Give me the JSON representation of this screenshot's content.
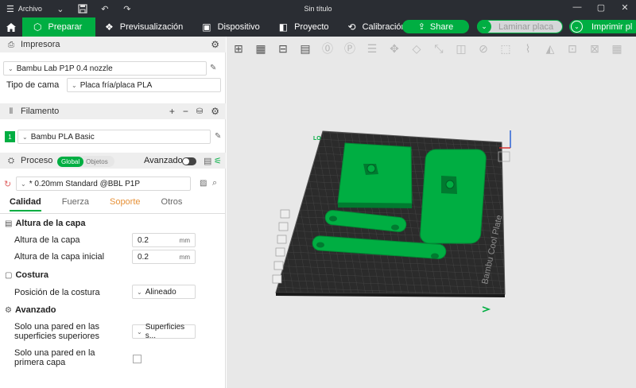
{
  "titlebar": {
    "menu_label": "Archivo",
    "window_title": "Sin título"
  },
  "toolbar": {
    "tabs": [
      {
        "label": "Preparar",
        "icon": "prepare-cube-icon"
      },
      {
        "label": "Previsualización",
        "icon": "preview-cubes-icon"
      },
      {
        "label": "Dispositivo",
        "icon": "device-monitor-icon"
      },
      {
        "label": "Proyecto",
        "icon": "project-book-icon"
      },
      {
        "label": "Calibración",
        "icon": "calibration-icon"
      }
    ],
    "share_label": "Share",
    "slice_label": "Laminar placa",
    "print_label": "Imprimir pl",
    "accent": "#00ae42"
  },
  "printer": {
    "section_title": "Impresora",
    "printer_name": "Bambu Lab P1P 0.4 nozzle",
    "bed_type_label": "Tipo de cama",
    "bed_type_value": "Placa fría/placa PLA"
  },
  "filament": {
    "section_title": "Filamento",
    "items": [
      {
        "index": "1",
        "name": "Bambu PLA Basic",
        "color": "#00ae42"
      }
    ]
  },
  "process": {
    "section_title": "Proceso",
    "toggle_global": "Global",
    "toggle_objects": "Objetos",
    "advanced_label": "Avanzado",
    "preset": "* 0.20mm Standard @BBL P1P",
    "tabs": [
      {
        "label": "Calidad",
        "active": true
      },
      {
        "label": "Fuerza",
        "active": false
      },
      {
        "label": "Soporte",
        "active": false,
        "highlight": "#e69138"
      },
      {
        "label": "Otros",
        "active": false
      }
    ]
  },
  "quality": {
    "layer_group": "Altura de la capa",
    "layer_height_label": "Altura de la capa",
    "layer_height_value": "0.2",
    "layer_height_unit": "mm",
    "initial_layer_label": "Altura de la capa inicial",
    "initial_layer_value": "0.2",
    "initial_layer_unit": "mm",
    "seam_group": "Costura",
    "seam_position_label": "Posición de la costura",
    "seam_position_value": "Alineado",
    "advanced_group": "Avanzado",
    "single_wall_top_label_1": "Solo una pared en las",
    "single_wall_top_label_2": "superficies superiores",
    "single_wall_top_value": "Superficies s...",
    "single_wall_first_label_1": "Solo una pared en la",
    "single_wall_first_label_2": "primera capa",
    "single_wall_first_checked": false
  },
  "viewport": {
    "plate_label": "Bambu Cool Plate",
    "plate_index_label": "LO",
    "object_color": "#00ae42"
  }
}
